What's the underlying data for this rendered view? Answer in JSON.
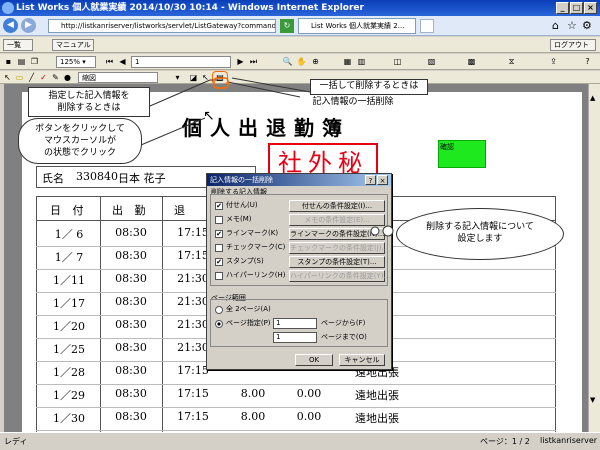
{
  "window": {
    "title": "List Works 個人就業実績 2014/10/30 10:14 - Windows Internet Explorer"
  },
  "browser": {
    "url": "http://listkanriserver/listworks/servlet/ListGateway?command=listbrow",
    "tab_label": "List Works 個人就業実績 2..."
  },
  "toolbar1": {
    "list_button": "一覧",
    "manual_button": "マニュアル",
    "logout_button": "ログアウト"
  },
  "toolbar2": {
    "zoom": "125%",
    "page_input": "1"
  },
  "toolbar3": {
    "label_field": "縮図"
  },
  "document": {
    "title": "個人出退勤簿",
    "stamp": "社外秘",
    "approval_label": "確認",
    "name_label": "氏名",
    "name_code": "330840",
    "name_value": "日本 花子",
    "col_date": "日 付",
    "col_in": "出 勤",
    "col_out": "退",
    "rows": [
      {
        "date": "1／ 6",
        "in": "08:30",
        "out": "17:15",
        "h1": "",
        "h2": "",
        "note": ""
      },
      {
        "date": "1／ 7",
        "in": "08:30",
        "out": "17:15",
        "h1": "",
        "h2": "",
        "note": ""
      },
      {
        "date": "1／11",
        "in": "08:30",
        "out": "21:30",
        "h1": "",
        "h2": "",
        "note": ""
      },
      {
        "date": "1／17",
        "in": "08:30",
        "out": "21:30",
        "h1": "",
        "h2": "",
        "note": ""
      },
      {
        "date": "1／20",
        "in": "08:30",
        "out": "21:30",
        "h1": "",
        "h2": "",
        "note": ""
      },
      {
        "date": "1／25",
        "in": "08:30",
        "out": "21:30",
        "h1": "",
        "h2": "",
        "note": ""
      },
      {
        "date": "1／28",
        "in": "08:30",
        "out": "17:15",
        "h1": "",
        "h2": "",
        "note": "遠地出張"
      },
      {
        "date": "1／29",
        "in": "08:30",
        "out": "17:15",
        "h1": "8.00",
        "h2": "0.00",
        "note": "遠地出張"
      },
      {
        "date": "1／30",
        "in": "08:30",
        "out": "17:15",
        "h1": "8.00",
        "h2": "0.00",
        "note": "遠地出張"
      }
    ]
  },
  "dialog": {
    "title": "記入情報の一括削除",
    "group_label": "削除する記入情報",
    "items": [
      {
        "label": "付せん(U)",
        "checked": "✔",
        "button": "付せんの条件設定(I)...",
        "enabled": true
      },
      {
        "label": "メモ(M)",
        "checked": "",
        "button": "メモの条件設定(E)...",
        "enabled": false
      },
      {
        "label": "ラインマーク(K)",
        "checked": "✔",
        "button": "ラインマークの条件設定(N)...",
        "enabled": true
      },
      {
        "label": "チェックマーク(C)",
        "checked": "",
        "button": "チェックマークの条件設定(J)...",
        "enabled": false
      },
      {
        "label": "スタンプ(S)",
        "checked": "✔",
        "button": "スタンプの条件設定(T)...",
        "enabled": true
      },
      {
        "label": "ハイパーリンク(H)",
        "checked": "",
        "button": "ハイパーリンクの条件設定(Y)...",
        "enabled": false
      }
    ],
    "page_range_label": "ページ範囲",
    "all_pages": "全 2ページ(A)",
    "page_spec": "ページ指定(P)",
    "from_value": "1",
    "from_label": "ページから(F)",
    "to_value": "1",
    "to_label": "ページまで(O)",
    "ok": "OK",
    "cancel": "キャンセル"
  },
  "callouts": {
    "c1": "指定した記入情報を\n削除するときは",
    "c2": "ボタンをクリックして\nマウスカーソルが\nの状態でクリック",
    "c3": "一括して削除するときは",
    "c4": "記入情報の一括削除",
    "c5": "削除する記入情報について\n設定します"
  },
  "status": {
    "left": "レディ",
    "page": "ページ：1 / 2",
    "server": "listkanriserver"
  },
  "colors": {
    "callout_border": "#333333",
    "highlight_border": "#ff6a00",
    "stamp_red": "#e60012",
    "approval_green": "#1ee81e"
  }
}
